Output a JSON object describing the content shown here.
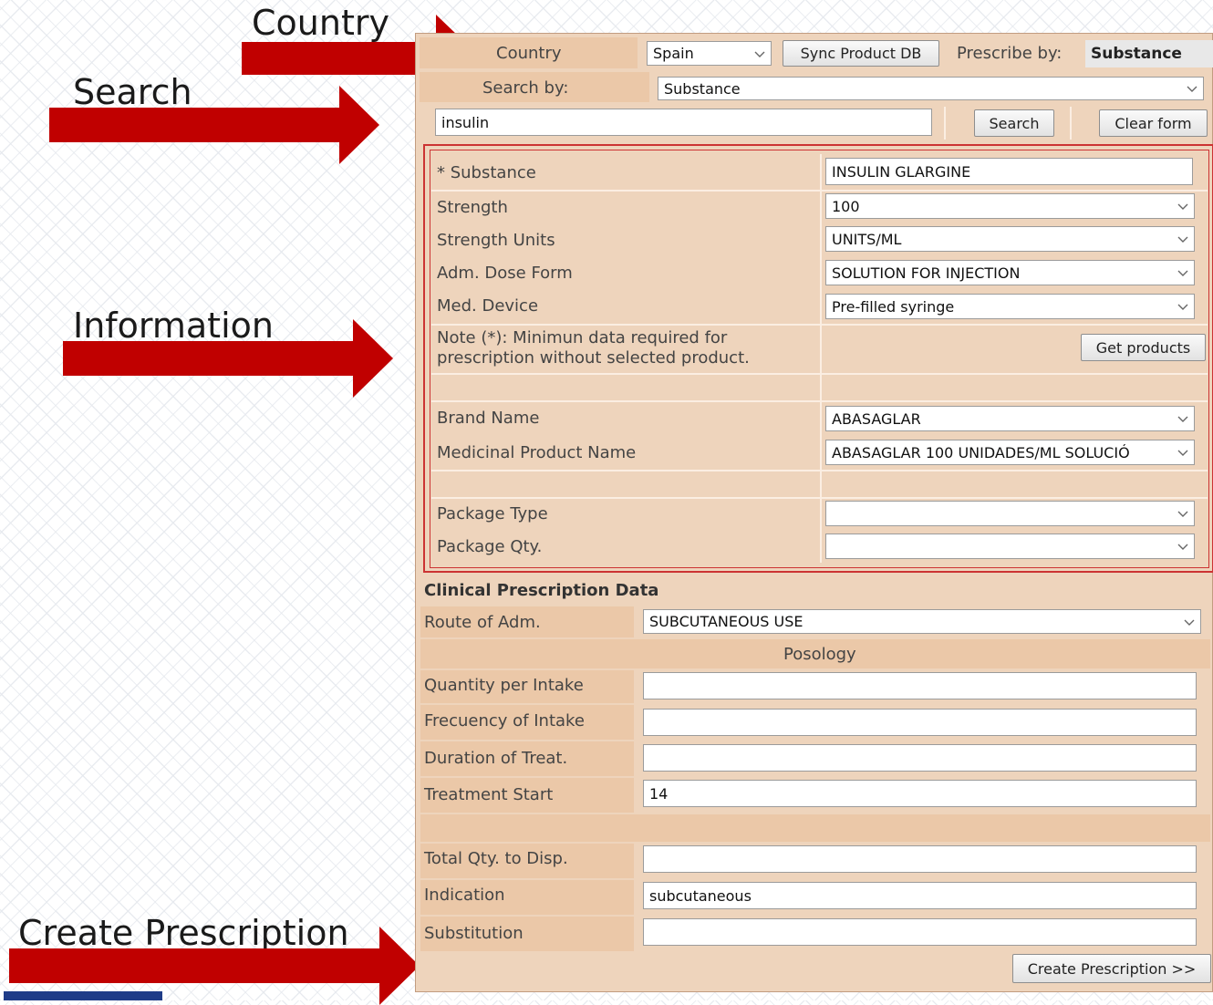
{
  "callouts": {
    "country": "Country",
    "search": "Search",
    "information": "Information",
    "create_prescription": "Create Prescription"
  },
  "header": {
    "country_label": "Country",
    "country_value": "Spain",
    "sync_button": "Sync Product DB",
    "prescribe_by_label": "Prescribe by:",
    "prescribe_by_value": "Substance",
    "search_by_label": "Search by:",
    "search_by_value": "Substance",
    "search_text": "insulin",
    "search_button": "Search",
    "clear_button": "Clear form"
  },
  "product": {
    "substance_label": "* Substance",
    "substance_value": "INSULIN GLARGINE",
    "strength_label": "Strength",
    "strength_value": "100",
    "strength_units_label": "Strength Units",
    "strength_units_value": "UNITS/ML",
    "dose_form_label": "Adm. Dose Form",
    "dose_form_value": "SOLUTION FOR INJECTION",
    "med_device_label": "Med. Device",
    "med_device_value": "Pre-filled syringe",
    "note_line1": "Note (*): Minimun data required for",
    "note_line2": "prescription without selected product.",
    "get_products_button": "Get products",
    "brand_label": "Brand Name",
    "brand_value": "ABASAGLAR",
    "product_name_label": "Medicinal Product Name",
    "product_name_value": "ABASAGLAR 100 UNIDADES/ML SOLUCIÓ",
    "package_type_label": "Package Type",
    "package_type_value": "",
    "package_qty_label": "Package Qty.",
    "package_qty_value": ""
  },
  "clinical": {
    "title": "Clinical Prescription Data",
    "route_label": "Route of Adm.",
    "route_value": "SUBCUTANEOUS USE",
    "posology_label": "Posology",
    "qty_intake_label": "Quantity per Intake",
    "qty_intake_value": "",
    "frequency_label": "Frecuency of Intake",
    "frequency_value": "",
    "duration_label": "Duration of Treat.",
    "duration_value": "",
    "treatment_start_label": "Treatment Start",
    "treatment_start_value": "14",
    "total_qty_label": "Total Qty. to Disp.",
    "total_qty_value": "",
    "indication_label": "Indication",
    "indication_value": "subcutaneous",
    "substitution_label": "Substitution",
    "substitution_value": "",
    "create_button": "Create Prescription >>"
  },
  "colors": {
    "panel_bg": "#eed4bc",
    "cell_bg": "#ebc8a8",
    "arrow": "#c00000",
    "section_border": "#cc3333"
  }
}
